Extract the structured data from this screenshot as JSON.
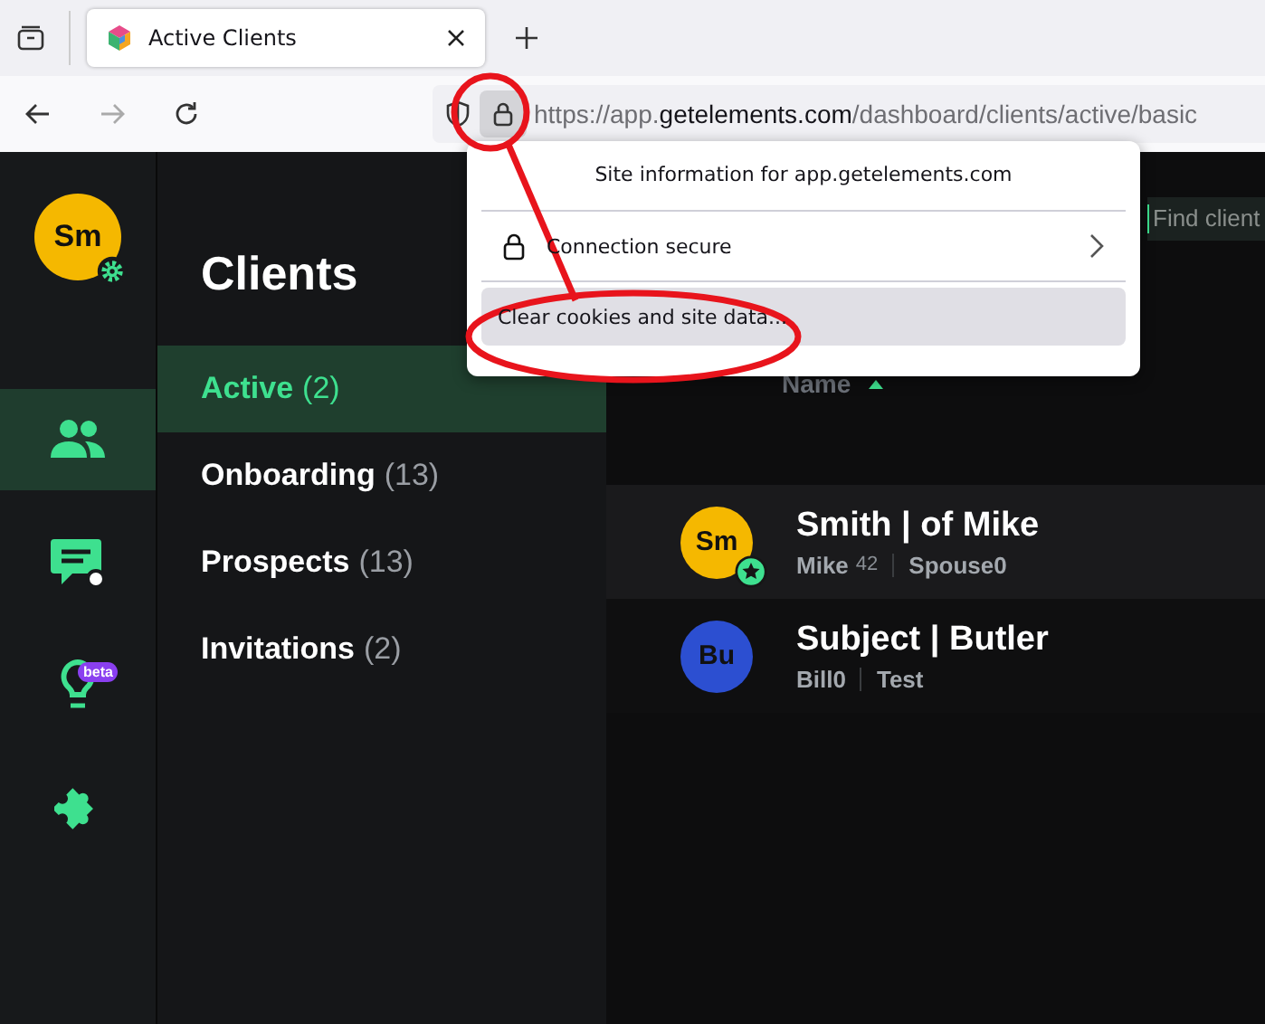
{
  "browser": {
    "tab": {
      "title": "Active Clients",
      "selected": true
    },
    "url": {
      "origin_prefix": "https://app.",
      "domain": "getelements.com",
      "path": "/dashboard/clients/active/basic"
    }
  },
  "site_info_popup": {
    "title": "Site information for app.getelements.com",
    "items": [
      {
        "kind": "link",
        "label": "Connection secure",
        "selected": false
      },
      {
        "kind": "action",
        "label": "Clear cookies and site data...",
        "selected": true
      }
    ]
  },
  "user_avatar": {
    "initials": "Sm",
    "color": "#f5b800"
  },
  "rail": [
    {
      "kind": "people",
      "selected": true
    },
    {
      "kind": "chat",
      "selected": false
    },
    {
      "kind": "idea",
      "selected": false,
      "badge": "beta"
    },
    {
      "kind": "puzzle",
      "selected": false
    }
  ],
  "nav": {
    "title": "Clients",
    "items": [
      {
        "label": "Active",
        "count": "(2)",
        "selected": true
      },
      {
        "label": "Onboarding",
        "count": "(13)",
        "selected": false
      },
      {
        "label": "Prospects",
        "count": "(13)",
        "selected": false
      },
      {
        "label": "Invitations",
        "count": "(2)",
        "selected": false
      }
    ]
  },
  "search": {
    "placeholder": "Find client"
  },
  "table": {
    "columns": [
      {
        "label": "Name",
        "sorted": true
      }
    ],
    "rows": [
      {
        "initials": "Sm",
        "color": "#f5b800",
        "starred": true,
        "highlighted": true,
        "name": "Smith | of Mike",
        "details": [
          {
            "text": "Mike",
            "note": "42"
          },
          {
            "text": "Spouse0"
          }
        ]
      },
      {
        "initials": "Bu",
        "color": "#2c4fd1",
        "starred": false,
        "highlighted": false,
        "name": "Subject | Butler",
        "details": [
          {
            "text": "Bill0"
          },
          {
            "text": "Test"
          }
        ]
      }
    ]
  }
}
